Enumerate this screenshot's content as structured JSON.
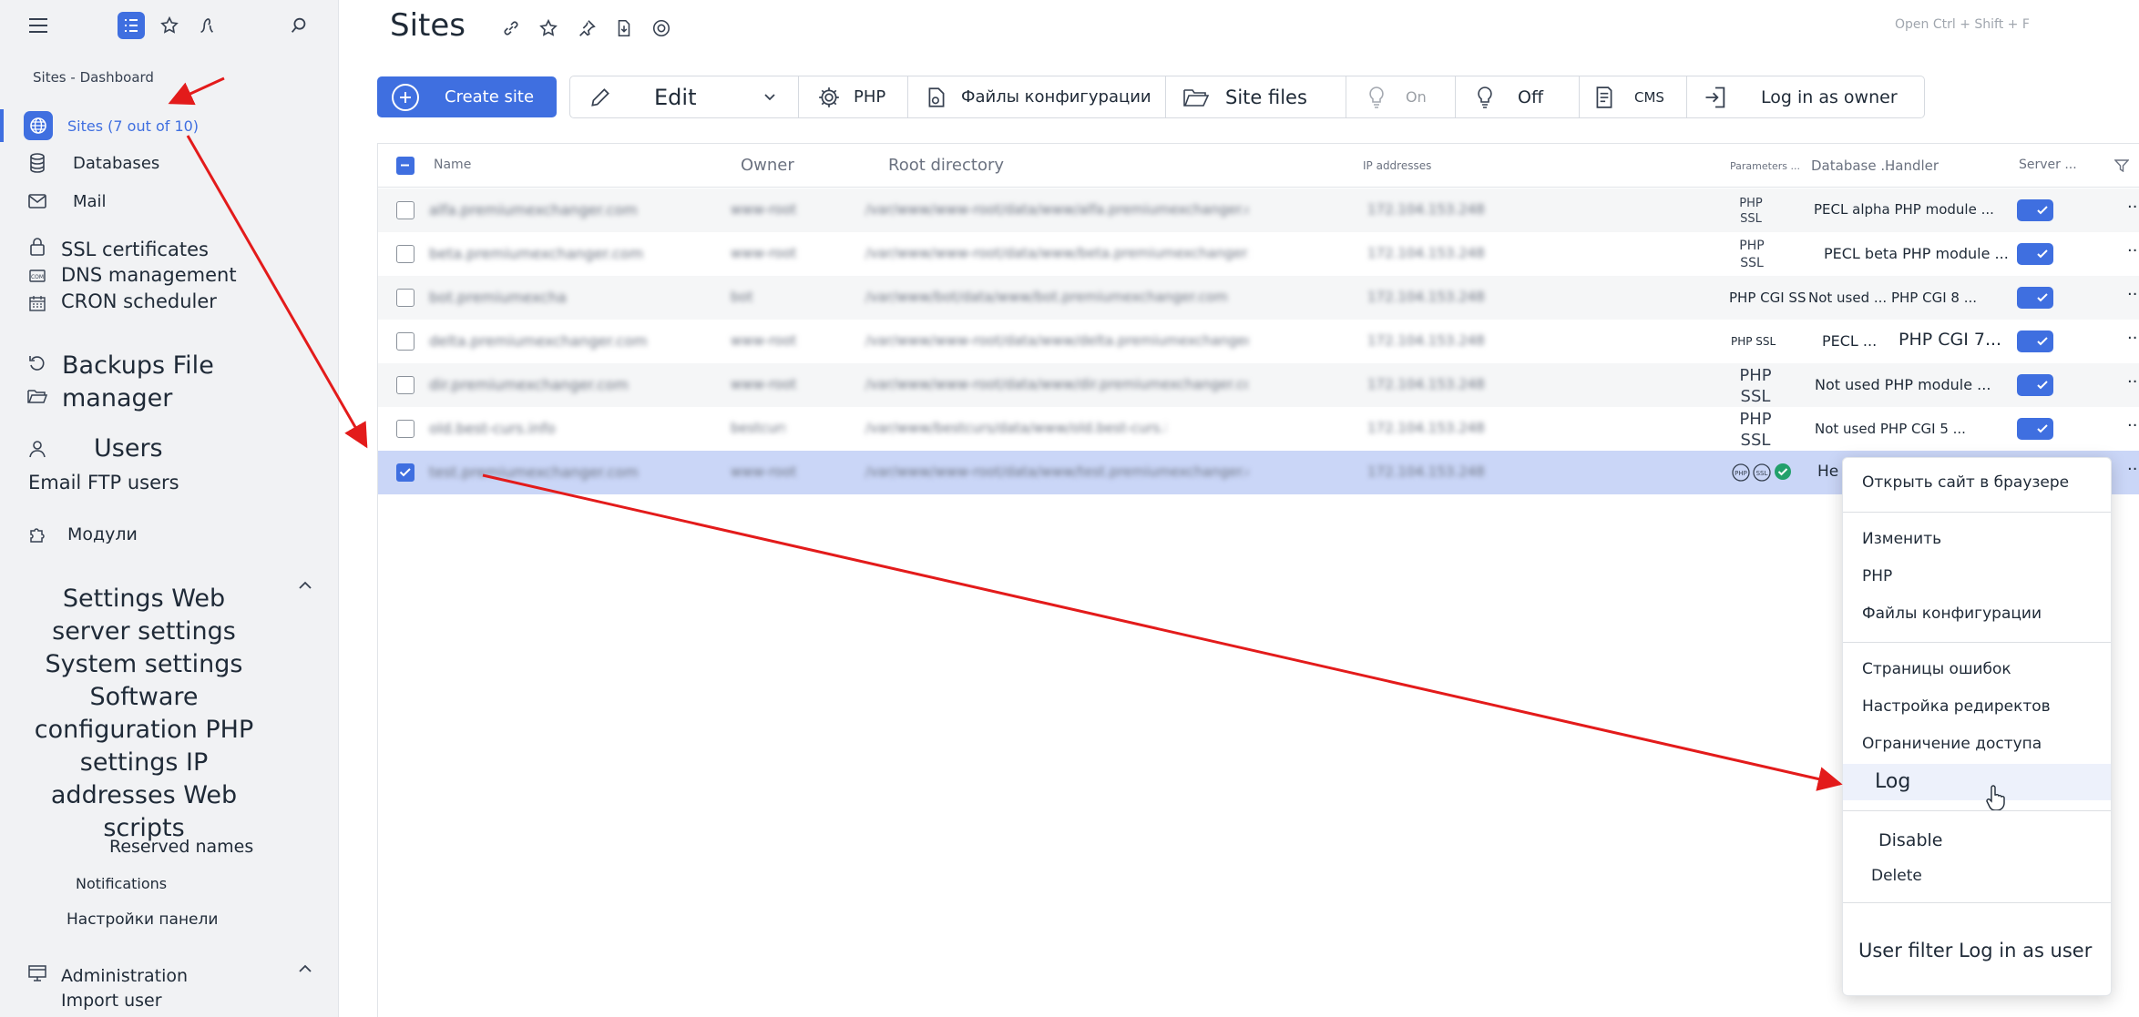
{
  "sidebar": {
    "breadcrumb": "Sites - Dashboard",
    "items": {
      "sites": "Sites (7 out of 10)",
      "databases": "Databases",
      "mail": "Mail",
      "ssl": "SSL certificates",
      "dns": "DNS management",
      "cron": "CRON scheduler",
      "backups": "Backups File manager",
      "users": "Users",
      "email_ftp": "Email FTP users",
      "modules": "Модули",
      "settings": "Settings Web server settings System settings Software configuration PHP settings IP addresses Web scripts",
      "reserved": "Reserved names",
      "notifications": "Notifications",
      "panel_settings": "Настройки панели",
      "administration": "Administration",
      "import_user": "Import user"
    }
  },
  "header": {
    "title": "Sites",
    "search_hint": "Open Ctrl + Shift + F"
  },
  "toolbar": {
    "create": "Create site",
    "edit": "Edit",
    "php": "PHP",
    "config_files": "Файлы конфигурации",
    "site_files": "Site files",
    "on": "On",
    "off": "Off",
    "cms": "CMS",
    "login_owner": "Log in as owner"
  },
  "table": {
    "columns": {
      "name": "Name",
      "owner": "Owner",
      "root": "Root directory",
      "ip": "IP addresses",
      "params": "Parameters ...",
      "database": "Database ...",
      "handler": "Handler",
      "server": "Server ..."
    },
    "rows": [
      {
        "name": "alfa.premiumexchanger.com",
        "owner": "www-root",
        "root": "/var/www/www-root/data/www/alfa.premiumexchanger.com",
        "ip": "172.104.153.248",
        "params": "PHP SSL",
        "handler": "PECL alpha PHP module ..."
      },
      {
        "name": "beta.premiumexchanger.com",
        "owner": "www-root",
        "root": "/var/www/www-root/data/www/beta.premiumexchanger.com",
        "ip": "172.104.153.248",
        "params": "PHP SSL",
        "handler": "PECL beta PHP module ..."
      },
      {
        "name": "bot.premiumexchanger.com",
        "owner": "bot",
        "root": "/var/www/bot/data/www/bot.premiumexchanger.com",
        "ip": "172.104.153.248",
        "params": "PHP CGI SS",
        "handler": "Not used ... PHP CGI 8 ..."
      },
      {
        "name": "delta.premiumexchanger.com",
        "owner": "www-root",
        "root": "/var/www/www-root/data/www/delta.premiumexchanger.com",
        "ip": "172.104.153.248",
        "params": "PHP SSL",
        "handler": "PECL ...",
        "handler2": "PHP CGI 7..."
      },
      {
        "name": "dir.premiumexchanger.com",
        "owner": "www-root",
        "root": "/var/www/www-root/data/www/dir.premiumexchanger.com",
        "ip": "172.104.153.248",
        "params": "PHP SSL",
        "handler": "Not used PHP module ..."
      },
      {
        "name": "old.best-curs.info",
        "owner": "bestcurs",
        "root": "/var/www/bestcurs/data/www/old.best-curs.info",
        "ip": "172.104.153.248",
        "params": "PHP SSL",
        "handler": "Not used PHP CGI 5 ..."
      },
      {
        "name": "test.premiumexchanger.com",
        "owner": "www-root",
        "root": "/var/www/www-root/data/www/test.premiumexchanger.com",
        "ip": "172.104.153.248",
        "params": "",
        "handler": "Не"
      }
    ]
  },
  "context_menu": {
    "open_browser": "Открыть сайт в браузере",
    "edit": "Изменить",
    "php": "PHP",
    "config": "Файлы конфигурации",
    "error_pages": "Страницы ошибок",
    "redirects": "Настройка редиректов",
    "access": "Ограничение доступа",
    "log": "Log",
    "disable": "Disable",
    "delete": "Delete",
    "user_filter": "User filter Log in as user"
  },
  "colors": {
    "accent": "#3f6fe0",
    "selected_row": "#cad6f7",
    "annotation": "#e31b1b"
  }
}
